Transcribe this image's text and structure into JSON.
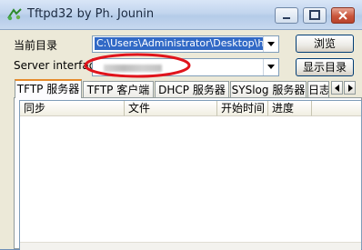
{
  "window": {
    "title": "Tftpd32 by Ph. Jounin",
    "icon": "tftpd32-app-icon",
    "controls": [
      "minimize-icon",
      "maximize-icon",
      "close-icon"
    ]
  },
  "form": {
    "current_dir_label": "当前目录",
    "current_dir_value": "C:\\Users\\Administrator\\Desktop\\ha_T",
    "server_interface_label": "Server interface",
    "server_interface_value": "",
    "browse_button": "浏览",
    "show_dir_button": "显示目录"
  },
  "tabs": [
    {
      "label": "TFTP 服务器",
      "active": true
    },
    {
      "label": "TFTP 客户端",
      "active": false
    },
    {
      "label": "DHCP 服务器",
      "active": false
    },
    {
      "label": "SYSlog 服务器",
      "active": false
    },
    {
      "label": "日志",
      "active": false
    }
  ],
  "table": {
    "columns": [
      "同步",
      "文件",
      "开始时间",
      "进度"
    ],
    "rows": []
  },
  "annotation": {
    "color": "#e0141c"
  }
}
